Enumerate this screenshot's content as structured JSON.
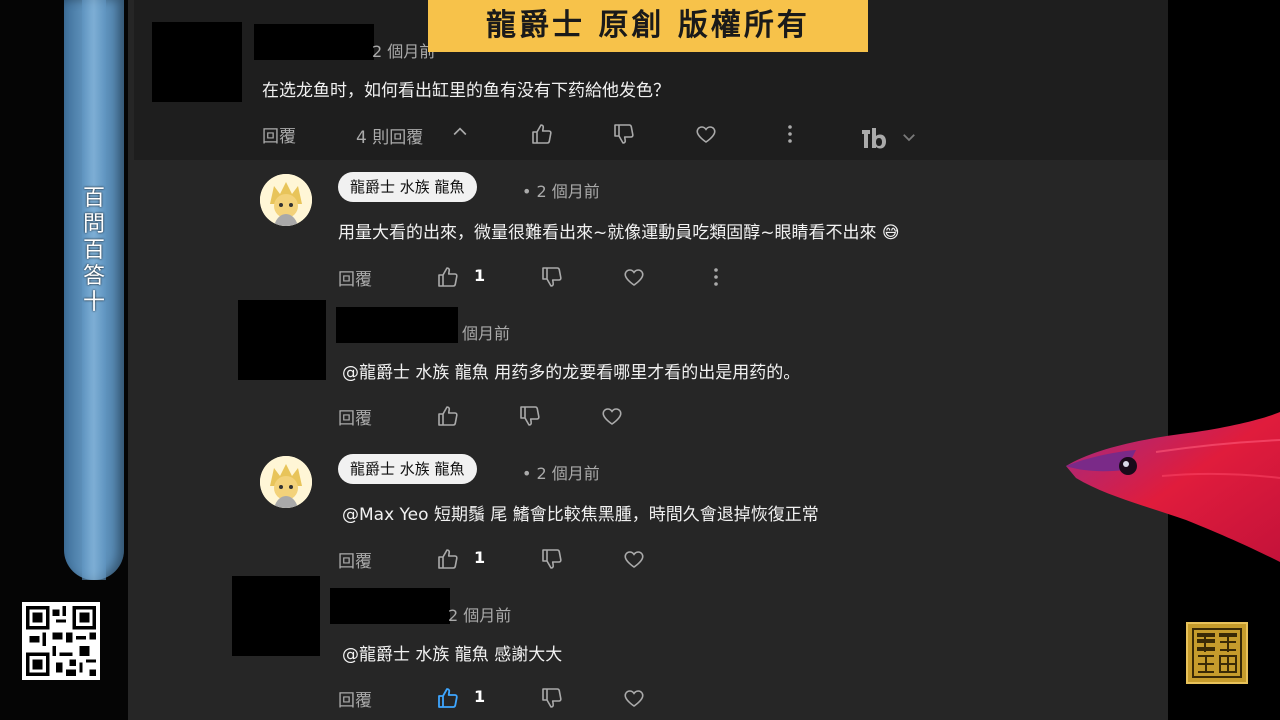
{
  "watermark": {
    "title": "龍爵士 原創 版權所有"
  },
  "banner": {
    "chars": [
      "百",
      "問",
      "百",
      "答",
      "十"
    ]
  },
  "top_comment": {
    "time_partial": "2 個月前",
    "text": "在选龙鱼时，如何看出缸里的鱼有没有下药給他发色？",
    "reply_label": "回覆",
    "replies_toggle": "4 則回覆"
  },
  "replies": [
    {
      "author": "龍爵士 水族 龍魚",
      "time": "• 2 個月前",
      "text": "用量大看的出來，微量很難看出來~就像運動員吃類固醇~眼睛看不出來 😅",
      "reply_label": "回覆",
      "likes": "1"
    },
    {
      "time": "個月前",
      "text": "@龍爵士 水族 龍魚  用药多的龙要看哪里才看的出是用药的。",
      "reply_label": "回覆"
    },
    {
      "author": "龍爵士 水族 龍魚",
      "time": "• 2 個月前",
      "text": "@Max Yeo  短期鬚 尾 鰭會比較焦黑腫，時間久會退掉恢復正常",
      "reply_label": "回覆",
      "likes": "1"
    },
    {
      "time": "2 個月前",
      "text": "@龍爵士 水族 龍魚  感謝大大",
      "reply_label": "回覆",
      "likes": "1"
    }
  ],
  "colors": {
    "background": "#262626",
    "top_comment_bg": "#1e1e1e",
    "watermark_bg": "#f7c24a",
    "liked_blue": "#3ea6ff",
    "icon_gray": "#aaaaaa"
  }
}
